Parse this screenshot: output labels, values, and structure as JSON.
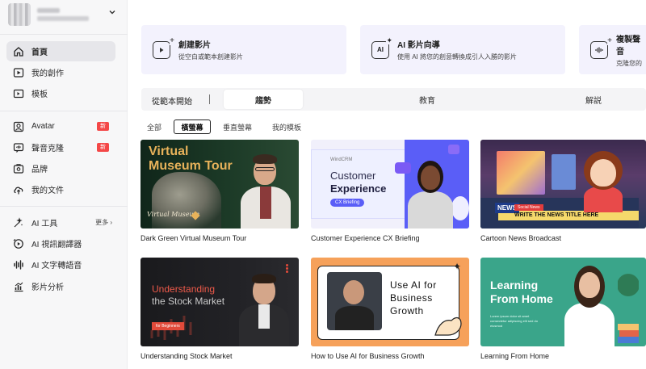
{
  "sidebar": {
    "items": [
      {
        "label": "首頁",
        "icon": "home-icon",
        "active": true
      },
      {
        "label": "我的創作",
        "icon": "video-play-icon"
      },
      {
        "label": "模板",
        "icon": "template-icon"
      },
      {
        "label": "Avatar",
        "icon": "avatar-icon",
        "badge": "新"
      },
      {
        "label": "聲音克隆",
        "icon": "voice-clone-icon",
        "badge": "新"
      },
      {
        "label": "品牌",
        "icon": "brand-icon"
      },
      {
        "label": "我的文件",
        "icon": "upload-cloud-icon"
      },
      {
        "label": "AI 工具",
        "icon": "ai-tools-icon",
        "more": "更多"
      },
      {
        "label": "AI 視訊翻譯器",
        "icon": "video-translate-icon"
      },
      {
        "label": "AI 文字轉語音",
        "icon": "audio-wave-icon"
      },
      {
        "label": "影片分析",
        "icon": "analytics-icon"
      }
    ]
  },
  "actions": [
    {
      "title": "創建影片",
      "subtitle": "從空白或範本創建影片",
      "icon": "create-video-icon"
    },
    {
      "title": "AI 影片向導",
      "subtitle": "使用 AI 將您的創意轉換成引人入勝的影片",
      "icon": "ai-wizard-icon"
    },
    {
      "title": "複製聲音",
      "subtitle": "克隆您的",
      "icon": "clone-voice-icon"
    }
  ],
  "categories": {
    "start_label": "從範本開始",
    "tabs": [
      "趨勢",
      "教育",
      "解説"
    ],
    "active": 0
  },
  "filters": {
    "options": [
      "全部",
      "橫螢幕",
      "垂直螢幕",
      "我的模板"
    ],
    "active": 1
  },
  "templates": [
    {
      "caption": "Dark Green Virtual Museum Tour",
      "title_line1": "Virtual",
      "title_line2": "Museum Tour",
      "script": "Virtual Museum"
    },
    {
      "caption": "Customer Experience CX Briefing",
      "brand": "WindCRM",
      "line1": "Customer",
      "line2": "Experience",
      "pill": "CX Briefing"
    },
    {
      "caption": "Cartoon News Broadcast",
      "news_tag": "NEWS",
      "social": "Social News",
      "ticker": "WRITE THE NEWS TITLE HERE"
    },
    {
      "caption": "Understanding Stock Market",
      "title_line1": "Understanding",
      "title_line2": "the Stock Market",
      "chip": "for Beginners"
    },
    {
      "caption": "How to Use AI for Business Growth",
      "line1": "Use AI for",
      "line2": "Business",
      "line3": "Growth"
    },
    {
      "caption": "Learning From Home",
      "title_line1": "Learning",
      "title_line2": "From Home",
      "sub": "Lorem ipsum dolor sit amet consectetur adipiscing elit sed do eiusmod"
    }
  ],
  "colors": {
    "accent_purple": "#5a5ef7",
    "badge_red": "#f44747",
    "action_card_bg": "#f3f2fd"
  }
}
